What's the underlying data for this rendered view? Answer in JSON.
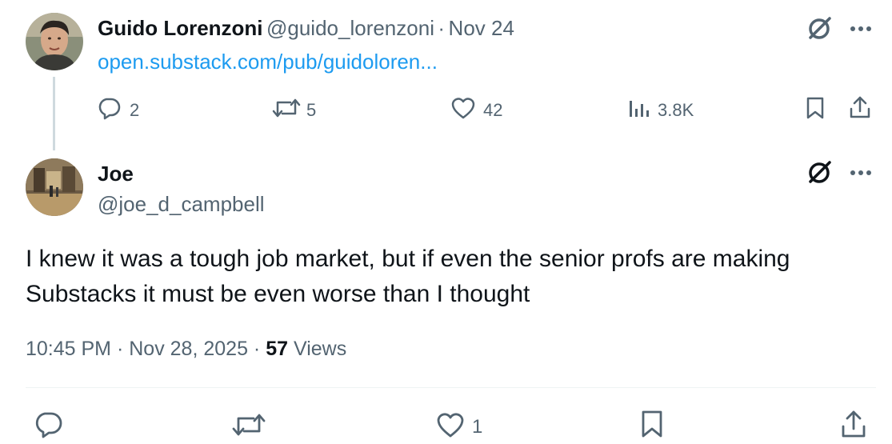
{
  "parent_tweet": {
    "author_name": "Guido Lorenzoni",
    "handle": "@guido_lorenzoni",
    "separator": "·",
    "date": "Nov 24",
    "link_text": "open.substack.com/pub/guidoloren...",
    "actions": {
      "replies": "2",
      "reposts": "5",
      "likes": "42",
      "views": "3.8K"
    }
  },
  "main_tweet": {
    "author_name": "Joe",
    "handle": "@joe_d_campbell",
    "text": "I knew it was a tough job market, but if even the senior profs are making Substacks it must be even worse than I thought",
    "time": "10:45 PM",
    "date": "Nov 28, 2025",
    "separator1": "·",
    "separator2": "·",
    "views_count": "57",
    "views_label": "Views",
    "actions": {
      "likes": "1"
    }
  },
  "icons": {
    "grok": "grok-icon",
    "more": "more-options-icon",
    "reply": "reply-icon",
    "repost": "repost-icon",
    "like": "like-icon",
    "views": "views-analytics-icon",
    "bookmark": "bookmark-icon",
    "share": "share-icon"
  },
  "colors": {
    "text": "#0f1419",
    "secondary": "#536471",
    "link": "#1d9bf0",
    "thread_line": "#cfd9de"
  }
}
